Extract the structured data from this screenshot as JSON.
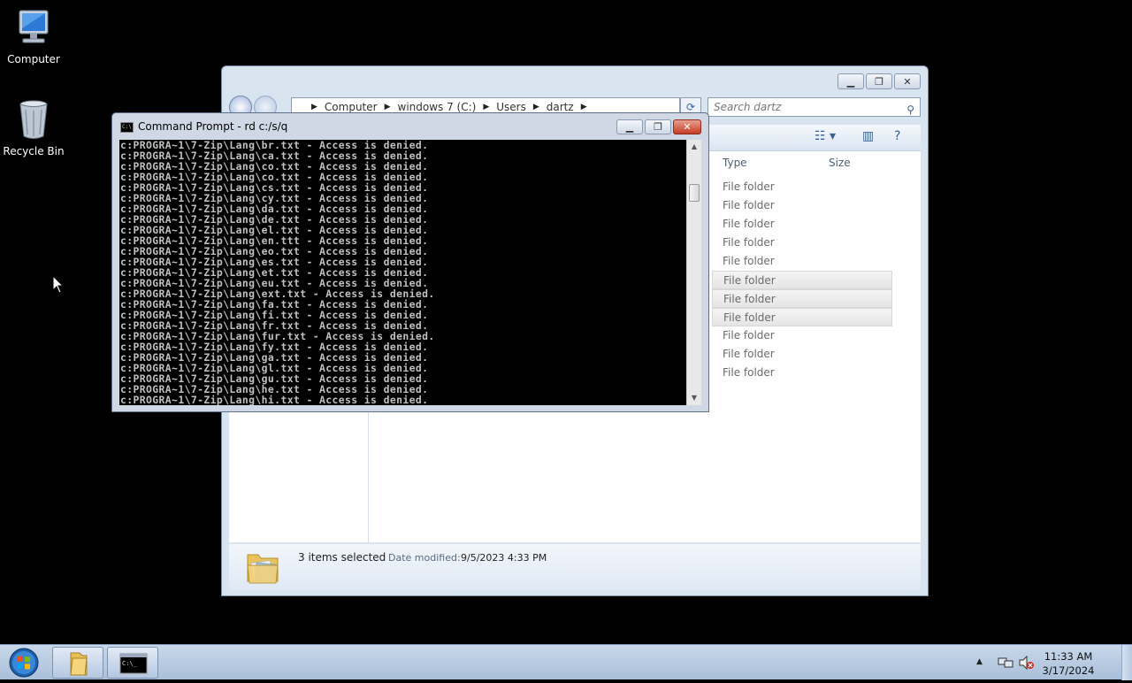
{
  "desktop": {
    "icons": [
      {
        "label": "Computer"
      },
      {
        "label": "Recycle Bin"
      }
    ]
  },
  "explorer": {
    "breadcrumb": [
      "Computer",
      "windows 7 (C:)",
      "Users",
      "dartz"
    ],
    "search_placeholder": "Search dartz",
    "columns": {
      "type": "Type",
      "size": "Size"
    },
    "rows": [
      {
        "type": "File folder",
        "selected": false
      },
      {
        "type": "File folder",
        "selected": false
      },
      {
        "type": "File folder",
        "selected": false
      },
      {
        "type": "File folder",
        "selected": false
      },
      {
        "type": "File folder",
        "selected": false
      },
      {
        "type": "File folder",
        "selected": true
      },
      {
        "type": "File folder",
        "selected": true
      },
      {
        "type": "File folder",
        "selected": true
      },
      {
        "type": "File folder",
        "selected": false
      },
      {
        "type": "File folder",
        "selected": false
      },
      {
        "type": "File folder",
        "selected": false
      }
    ],
    "details": {
      "selection": "3 items selected",
      "date_modified_label": "Date modified:",
      "date_modified_value": "9/5/2023 4:33 PM"
    }
  },
  "cmd": {
    "title": "Command Prompt - rd  c:/s/q",
    "lines": [
      "c:PROGRA~1\\7-Zip\\Lang\\br.txt - Access is denied.",
      "c:PROGRA~1\\7-Zip\\Lang\\ca.txt - Access is denied.",
      "c:PROGRA~1\\7-Zip\\Lang\\co.txt - Access is denied.",
      "c:PROGRA~1\\7-Zip\\Lang\\co.txt - Access is denied.",
      "c:PROGRA~1\\7-Zip\\Lang\\cs.txt - Access is denied.",
      "c:PROGRA~1\\7-Zip\\Lang\\cy.txt - Access is denied.",
      "c:PROGRA~1\\7-Zip\\Lang\\da.txt - Access is denied.",
      "c:PROGRA~1\\7-Zip\\Lang\\de.txt - Access is denied.",
      "c:PROGRA~1\\7-Zip\\Lang\\el.txt - Access is denied.",
      "c:PROGRA~1\\7-Zip\\Lang\\en.ttt - Access is denied.",
      "c:PROGRA~1\\7-Zip\\Lang\\eo.txt - Access is denied.",
      "c:PROGRA~1\\7-Zip\\Lang\\es.txt - Access is denied.",
      "c:PROGRA~1\\7-Zip\\Lang\\et.txt - Access is denied.",
      "c:PROGRA~1\\7-Zip\\Lang\\eu.txt - Access is denied.",
      "c:PROGRA~1\\7-Zip\\Lang\\ext.txt - Access is denied.",
      "c:PROGRA~1\\7-Zip\\Lang\\fa.txt - Access is denied.",
      "c:PROGRA~1\\7-Zip\\Lang\\fi.txt - Access is denied.",
      "c:PROGRA~1\\7-Zip\\Lang\\fr.txt - Access is denied.",
      "c:PROGRA~1\\7-Zip\\Lang\\fur.txt - Access is denied.",
      "c:PROGRA~1\\7-Zip\\Lang\\fy.txt - Access is denied.",
      "c:PROGRA~1\\7-Zip\\Lang\\ga.txt - Access is denied.",
      "c:PROGRA~1\\7-Zip\\Lang\\gl.txt - Access is denied.",
      "c:PROGRA~1\\7-Zip\\Lang\\gu.txt - Access is denied.",
      "c:PROGRA~1\\7-Zip\\Lang\\he.txt - Access is denied.",
      "c:PROGRA~1\\7-Zip\\Lang\\hi.txt - Access is denied."
    ]
  },
  "taskbar": {
    "time": "11:33 AM",
    "date": "3/17/2024",
    "buttons": [
      {
        "icon": "folder-icon"
      },
      {
        "icon": "command-prompt-icon"
      }
    ]
  },
  "colors": {
    "desktop_bg": "#000000",
    "console_text": "#c0c0c0",
    "close_red": "#c53b25"
  }
}
